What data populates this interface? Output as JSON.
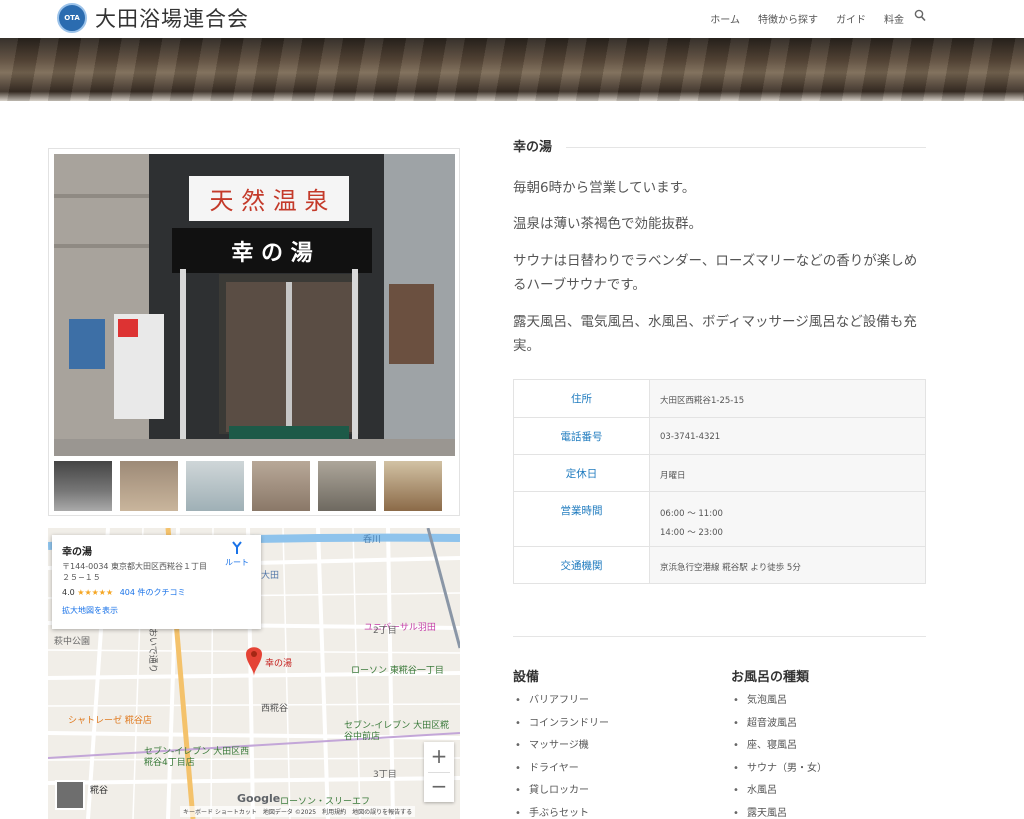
{
  "header": {
    "logo_mark": "OTA",
    "site_title": "大田浴場連合会",
    "nav": [
      "ホーム",
      "特徴から探す",
      "ガイド",
      "料金"
    ]
  },
  "place": {
    "name": "幸の湯",
    "description": [
      "毎朝6時から営業しています。",
      "温泉は薄い茶褐色で効能抜群。",
      "サウナは日替わりでラベンダー、ローズマリーなどの香りが楽しめるハーブサウナです。",
      "露天風呂、電気風呂、水風呂、ボディマッサージ風呂など設備も充実。"
    ],
    "sign_text": "幸 の 湯",
    "sign_top": "天 然 温 泉"
  },
  "info": {
    "address_label": "住所",
    "address": "大田区西糀谷1-25-15",
    "phone_label": "電話番号",
    "phone": "03-3741-4321",
    "closed_label": "定休日",
    "closed": "月曜日",
    "hours_label": "営業時間",
    "hours1": "06:00 〜 11:00",
    "hours2": "14:00 〜 23:00",
    "transit_label": "交通機関",
    "transit": "京浜急行空港線 糀谷駅 より徒歩 5分"
  },
  "map": {
    "card_title": "幸の湯",
    "card_address": "〒144-0034 東京都大田区西糀谷１丁目２５−１５",
    "rating": "4.0",
    "stars": "★★★★★",
    "reviews": "404 件のクチコミ",
    "enlarge": "拡大地図を表示",
    "route": "ルート",
    "pin_label": "幸の湯",
    "labels": {
      "l1": "大田",
      "l2": "ユニバーサル羽田",
      "l3": "2丁目",
      "l4": "萩中公園",
      "l5": "ローソン 東糀谷一丁目",
      "l6": "西糀谷",
      "l7": "シャトレーゼ 糀谷店",
      "l8": "セブン-イレブン 大田区糀谷中前店",
      "l9": "セブン-イレブン 大田区西糀谷4丁目店",
      "l10": "3丁目",
      "l11": "糀谷",
      "l12": "ローソン・スリーエフ",
      "l13": "呑川",
      "l14": "おいで通り"
    },
    "zoom_in": "+",
    "zoom_out": "−",
    "google": "Google",
    "footer": "キーボード ショートカット　地図データ ©2025　利用規約　地図の誤りを報告する"
  },
  "facilities": {
    "title": "設備",
    "items": [
      "バリアフリー",
      "コインランドリー",
      "マッサージ機",
      "ドライヤー",
      "貸しロッカー",
      "手ぶらセット"
    ]
  },
  "bath_types": {
    "title": "お風呂の種類",
    "items": [
      "気泡風呂",
      "超音波風呂",
      "座、寝風呂",
      "サウナ（男・女）",
      "水風呂",
      "露天風呂"
    ]
  }
}
